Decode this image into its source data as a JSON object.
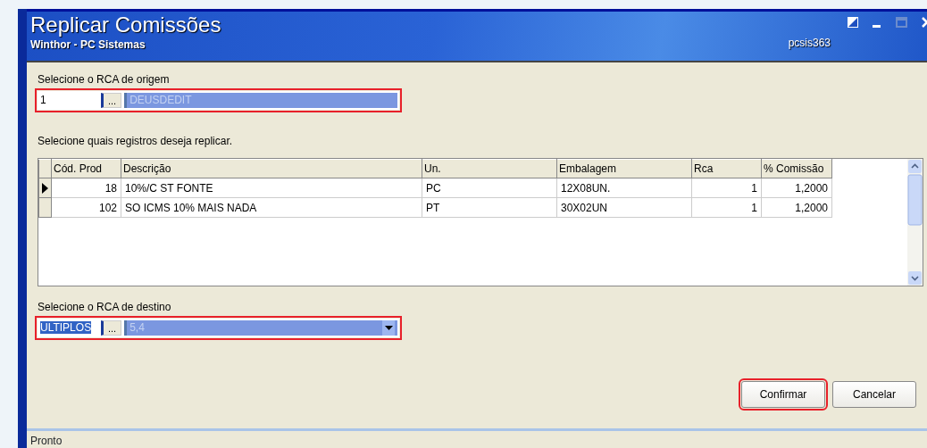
{
  "window": {
    "title": "Replicar Comissões",
    "subtitle": "Winthor - PC Sistemas",
    "user": "pcsis363"
  },
  "origin": {
    "label": "Selecione o RCA de origem",
    "code": "1",
    "lookup": "...",
    "name": "DEUSDEDIT",
    "highlighted": true,
    "code_selected": false,
    "dropdown": false
  },
  "table": {
    "caption": "Selecione quais registros deseja replicar.",
    "columns": [
      "Cód. Prod",
      "Descrição",
      "Un.",
      "Embalagem",
      "Rca",
      "% Comissão"
    ],
    "rows": [
      {
        "selected": true,
        "cells": [
          "18",
          "10%/C ST FONTE",
          "PC",
          "12X08UN.",
          "1",
          "1,2000"
        ]
      },
      {
        "selected": false,
        "cells": [
          "102",
          "SO ICMS 10% MAIS NADA",
          "PT",
          "30X02UN",
          "1",
          "1,2000"
        ]
      }
    ]
  },
  "destination": {
    "label": "Selecione o RCA de destino",
    "code": "ULTIPLOS",
    "lookup": "...",
    "name": "5,4",
    "highlighted": true,
    "code_selected": true,
    "dropdown": true
  },
  "buttons": [
    {
      "label": "Confirmar",
      "highlighted": true
    },
    {
      "label": "Cancelar",
      "highlighted": false
    }
  ],
  "status_bar": "Pronto"
}
